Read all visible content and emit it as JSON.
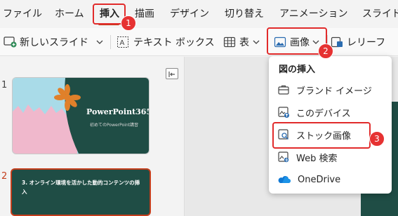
{
  "tabs": [
    "ファイル",
    "ホーム",
    "挿入",
    "描画",
    "デザイン",
    "切り替え",
    "アニメーション",
    "スライド"
  ],
  "ribbon": {
    "new_slide": "新しいスライド",
    "text_box": "テキスト ボックス",
    "table": "表",
    "image": "画像",
    "relief": "レリーフ"
  },
  "menu": {
    "title": "図の挿入",
    "items": [
      {
        "label": "ブランド イメージ",
        "icon": "briefcase-icon"
      },
      {
        "label": "このデバイス",
        "icon": "device-image-icon"
      },
      {
        "label": "ストック画像",
        "icon": "stock-image-icon"
      },
      {
        "label": "Web 検索",
        "icon": "web-search-image-icon"
      },
      {
        "label": "OneDrive",
        "icon": "onedrive-icon"
      }
    ]
  },
  "slides": [
    {
      "number": "1",
      "title": "PowerPoint365",
      "subtitle": "初めてのPowerPoint講習"
    },
    {
      "number": "2",
      "title": "3. オンライン環境を活かした動的コンテンツの挿入"
    }
  ],
  "badges": [
    "1",
    "2",
    "3"
  ],
  "colors": {
    "accent": "#c43e1c",
    "highlight": "#e12b2b",
    "badge": "#e63232",
    "slide_dark": "#1f4d45",
    "slide_pink": "#f0b8cc",
    "slide_sky": "#a9dbe8",
    "flower": "#e0802a"
  }
}
